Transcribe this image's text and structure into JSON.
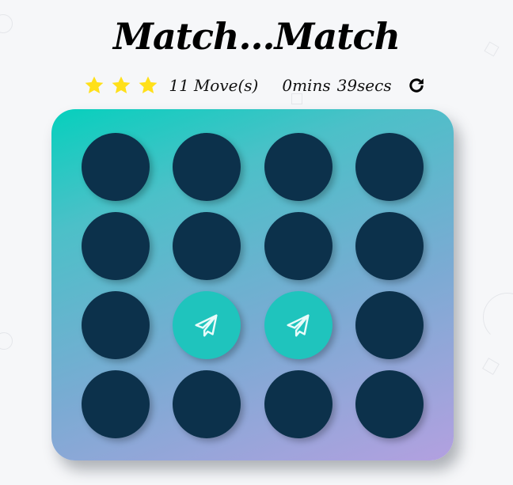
{
  "header": {
    "title": "Match...Match"
  },
  "score_panel": {
    "stars": {
      "filled": 3,
      "total": 3,
      "color": "#ffe01a"
    },
    "moves_count": "11",
    "moves_label": "Move(s)",
    "timer_minutes": "0mins",
    "timer_seconds": "39secs",
    "restart_icon": "redo-icon"
  },
  "deck": {
    "rows": 4,
    "cols": 4,
    "card_back_color": "#0c314b",
    "card_open_color": "#1fc4bd",
    "cards": [
      {
        "state": "closed"
      },
      {
        "state": "closed"
      },
      {
        "state": "closed"
      },
      {
        "state": "closed"
      },
      {
        "state": "closed"
      },
      {
        "state": "closed"
      },
      {
        "state": "closed"
      },
      {
        "state": "closed"
      },
      {
        "state": "closed"
      },
      {
        "state": "open",
        "icon": "paper-plane-icon"
      },
      {
        "state": "open",
        "icon": "paper-plane-icon"
      },
      {
        "state": "closed"
      },
      {
        "state": "closed"
      },
      {
        "state": "closed"
      },
      {
        "state": "closed"
      },
      {
        "state": "closed"
      }
    ]
  }
}
